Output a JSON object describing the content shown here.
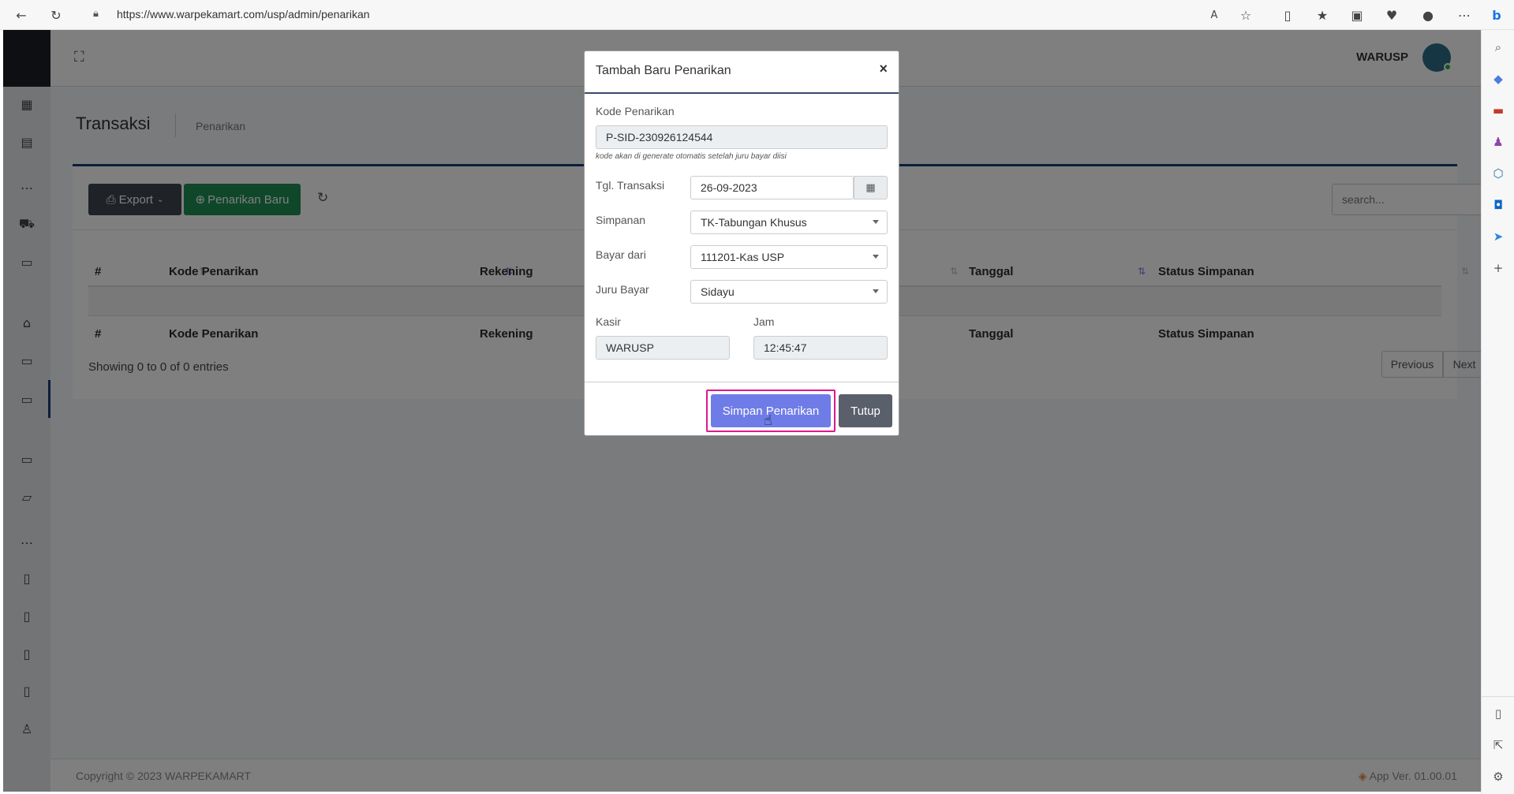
{
  "browser": {
    "url": "https://www.warpekamart.com/usp/admin/penarikan"
  },
  "app": {
    "user_name": "WARUSP",
    "page_title": "Transaksi",
    "breadcrumb": "Penarikan",
    "toolbar": {
      "export_label": "Export",
      "new_label": "Penarikan Baru",
      "search_placeholder": "search..."
    },
    "table": {
      "columns": [
        "#",
        "Kode Penarikan",
        "Rekening",
        "Tanggal",
        "Status Simpanan"
      ],
      "info": "Showing 0 to 0 of 0 entries",
      "previous": "Previous",
      "next": "Next"
    },
    "footer": {
      "copyright": "Copyright © 2023 WARPEKAMART",
      "version": "App Ver. 01.00.01"
    }
  },
  "modal": {
    "title": "Tambah Baru Penarikan",
    "close": "×",
    "kode_label": "Kode Penarikan",
    "kode_value": "P-SID-230926124544",
    "kode_hint": "kode akan di generate otomatis setelah juru bayar diisi",
    "tgl_label": "Tgl. Transaksi",
    "tgl_value": "26-09-2023",
    "simpanan_label": "Simpanan",
    "simpanan_value": "TK-Tabungan Khusus",
    "bayar_label": "Bayar dari",
    "bayar_value": "111201-Kas USP",
    "juru_label": "Juru Bayar",
    "juru_value": "Sidayu",
    "kasir_label": "Kasir",
    "kasir_value": "WARUSP",
    "jam_label": "Jam",
    "jam_value": "12:45:47",
    "save_label": "Simpan Penarikan",
    "close_label": "Tutup"
  },
  "colors": {
    "accent_primary": "#6f7ce8",
    "accent_success": "#1e8e55",
    "highlight": "#e0178a",
    "sidebar_dark": "#1c1f24",
    "header_line": "#1a3a7a"
  }
}
